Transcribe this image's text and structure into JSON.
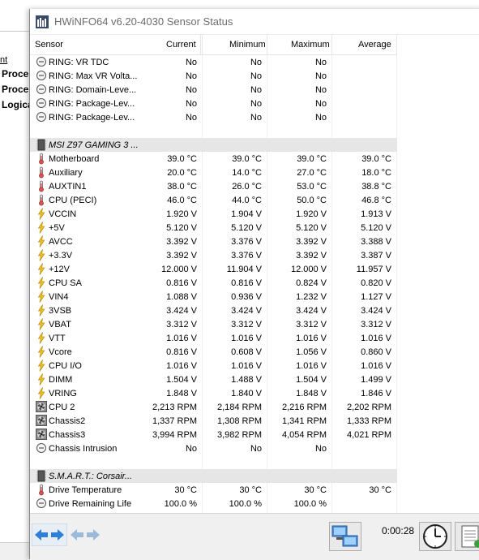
{
  "background_window": {
    "link_text": "nt",
    "items": [
      "Proce",
      "Proce",
      "Logica"
    ]
  },
  "window": {
    "title": "HWiNFO64 v6.20-4030 Sensor Status"
  },
  "columns": {
    "sensor": "Sensor",
    "current": "Current",
    "minimum": "Minimum",
    "maximum": "Maximum",
    "average": "Average"
  },
  "rows": [
    {
      "type": "sensor",
      "icon": "clock-icon",
      "name": "RING: VR TDC",
      "cur": "No",
      "min": "No",
      "max": "No",
      "avg": ""
    },
    {
      "type": "sensor",
      "icon": "clock-icon",
      "name": "RING: Max VR Volta...",
      "cur": "No",
      "min": "No",
      "max": "No",
      "avg": ""
    },
    {
      "type": "sensor",
      "icon": "clock-icon",
      "name": "RING: Domain-Leve...",
      "cur": "No",
      "min": "No",
      "max": "No",
      "avg": ""
    },
    {
      "type": "sensor",
      "icon": "clock-icon",
      "name": "RING: Package-Lev...",
      "cur": "No",
      "min": "No",
      "max": "No",
      "avg": ""
    },
    {
      "type": "sensor",
      "icon": "clock-icon",
      "name": "RING: Package-Lev...",
      "cur": "No",
      "min": "No",
      "max": "No",
      "avg": ""
    },
    {
      "type": "blank"
    },
    {
      "type": "group",
      "icon": "chip-icon",
      "name": "MSI Z97 GAMING 3 ..."
    },
    {
      "type": "sensor",
      "icon": "thermometer-icon",
      "name": "Motherboard",
      "cur": "39.0 °C",
      "min": "39.0 °C",
      "max": "39.0 °C",
      "avg": "39.0 °C"
    },
    {
      "type": "sensor",
      "icon": "thermometer-icon",
      "name": "Auxiliary",
      "cur": "20.0 °C",
      "min": "14.0 °C",
      "max": "27.0 °C",
      "avg": "18.0 °C"
    },
    {
      "type": "sensor",
      "icon": "thermometer-icon",
      "name": "AUXTIN1",
      "cur": "38.0 °C",
      "min": "26.0 °C",
      "max": "53.0 °C",
      "avg": "38.8 °C"
    },
    {
      "type": "sensor",
      "icon": "thermometer-icon",
      "name": "CPU (PECI)",
      "cur": "46.0 °C",
      "min": "44.0 °C",
      "max": "50.0 °C",
      "avg": "46.8 °C"
    },
    {
      "type": "sensor",
      "icon": "lightning-icon",
      "name": "VCCIN",
      "cur": "1.920 V",
      "min": "1.904 V",
      "max": "1.920 V",
      "avg": "1.913 V"
    },
    {
      "type": "sensor",
      "icon": "lightning-icon",
      "name": "+5V",
      "cur": "5.120 V",
      "min": "5.120 V",
      "max": "5.120 V",
      "avg": "5.120 V"
    },
    {
      "type": "sensor",
      "icon": "lightning-icon",
      "name": "AVCC",
      "cur": "3.392 V",
      "min": "3.376 V",
      "max": "3.392 V",
      "avg": "3.388 V"
    },
    {
      "type": "sensor",
      "icon": "lightning-icon",
      "name": "+3.3V",
      "cur": "3.392 V",
      "min": "3.376 V",
      "max": "3.392 V",
      "avg": "3.387 V"
    },
    {
      "type": "sensor",
      "icon": "lightning-icon",
      "name": "+12V",
      "cur": "12.000 V",
      "min": "11.904 V",
      "max": "12.000 V",
      "avg": "11.957 V"
    },
    {
      "type": "sensor",
      "icon": "lightning-icon",
      "name": "CPU SA",
      "cur": "0.816 V",
      "min": "0.816 V",
      "max": "0.824 V",
      "avg": "0.820 V"
    },
    {
      "type": "sensor",
      "icon": "lightning-icon",
      "name": "VIN4",
      "cur": "1.088 V",
      "min": "0.936 V",
      "max": "1.232 V",
      "avg": "1.127 V"
    },
    {
      "type": "sensor",
      "icon": "lightning-icon",
      "name": "3VSB",
      "cur": "3.424 V",
      "min": "3.424 V",
      "max": "3.424 V",
      "avg": "3.424 V"
    },
    {
      "type": "sensor",
      "icon": "lightning-icon",
      "name": "VBAT",
      "cur": "3.312 V",
      "min": "3.312 V",
      "max": "3.312 V",
      "avg": "3.312 V"
    },
    {
      "type": "sensor",
      "icon": "lightning-icon",
      "name": "VTT",
      "cur": "1.016 V",
      "min": "1.016 V",
      "max": "1.016 V",
      "avg": "1.016 V"
    },
    {
      "type": "sensor",
      "icon": "lightning-icon",
      "name": "Vcore",
      "cur": "0.816 V",
      "min": "0.608 V",
      "max": "1.056 V",
      "avg": "0.860 V"
    },
    {
      "type": "sensor",
      "icon": "lightning-icon",
      "name": "CPU I/O",
      "cur": "1.016 V",
      "min": "1.016 V",
      "max": "1.016 V",
      "avg": "1.016 V"
    },
    {
      "type": "sensor",
      "icon": "lightning-icon",
      "name": "DIMM",
      "cur": "1.504 V",
      "min": "1.488 V",
      "max": "1.504 V",
      "avg": "1.499 V"
    },
    {
      "type": "sensor",
      "icon": "lightning-icon",
      "name": "VRING",
      "cur": "1.848 V",
      "min": "1.840 V",
      "max": "1.848 V",
      "avg": "1.846 V"
    },
    {
      "type": "sensor",
      "icon": "fan-icon",
      "name": "CPU 2",
      "cur": "2,213 RPM",
      "min": "2,184 RPM",
      "max": "2,216 RPM",
      "avg": "2,202 RPM"
    },
    {
      "type": "sensor",
      "icon": "fan-icon",
      "name": "Chassis2",
      "cur": "1,337 RPM",
      "min": "1,308 RPM",
      "max": "1,341 RPM",
      "avg": "1,333 RPM"
    },
    {
      "type": "sensor",
      "icon": "fan-icon",
      "name": "Chassis3",
      "cur": "3,994 RPM",
      "min": "3,982 RPM",
      "max": "4,054 RPM",
      "avg": "4,021 RPM"
    },
    {
      "type": "sensor",
      "icon": "clock-icon",
      "name": "Chassis Intrusion",
      "cur": "No",
      "min": "No",
      "max": "No",
      "avg": ""
    },
    {
      "type": "blank"
    },
    {
      "type": "group",
      "icon": "drive-icon",
      "name": "S.M.A.R.T.: Corsair..."
    },
    {
      "type": "sensor",
      "icon": "thermometer-icon",
      "name": "Drive Temperature",
      "cur": "30 °C",
      "min": "30 °C",
      "max": "30 °C",
      "avg": "30 °C"
    },
    {
      "type": "sensor",
      "icon": "clock-icon",
      "name": "Drive Remaining Life",
      "cur": "100.0 %",
      "min": "100.0 %",
      "max": "100.0 %",
      "avg": ""
    }
  ],
  "statusbar": {
    "elapsed_time": "0:00:28"
  },
  "colors": {
    "group_bg": "#e6e6e6",
    "arrow_blue": "#2f7fd6",
    "arrow_disabled": "#9bb9d8",
    "lightning": "#f2c42a",
    "thermo_red": "#d9534f"
  }
}
